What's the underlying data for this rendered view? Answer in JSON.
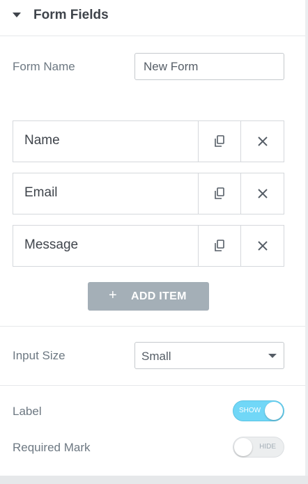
{
  "section": {
    "title": "Form Fields"
  },
  "form_name": {
    "label": "Form Name",
    "value": "New Form"
  },
  "fields": {
    "items": [
      {
        "label": "Name"
      },
      {
        "label": "Email"
      },
      {
        "label": "Message"
      }
    ]
  },
  "add_item_label": "ADD ITEM",
  "input_size": {
    "label": "Input Size",
    "selected": "Small"
  },
  "label_toggle": {
    "label": "Label",
    "state_text": "SHOW",
    "on": true
  },
  "required_mark_toggle": {
    "label": "Required Mark",
    "state_text": "HIDE",
    "on": false
  },
  "colors": {
    "toggle_on": "#71d7f7",
    "add_button": "#a4afb7",
    "heading_text": "#3f444b",
    "label_text": "#6d7882"
  },
  "icons": {
    "section_toggle": "caret-down-icon",
    "duplicate": "duplicate-icon",
    "remove": "close-icon",
    "add": "plus-icon",
    "select": "chevron-down-icon"
  }
}
